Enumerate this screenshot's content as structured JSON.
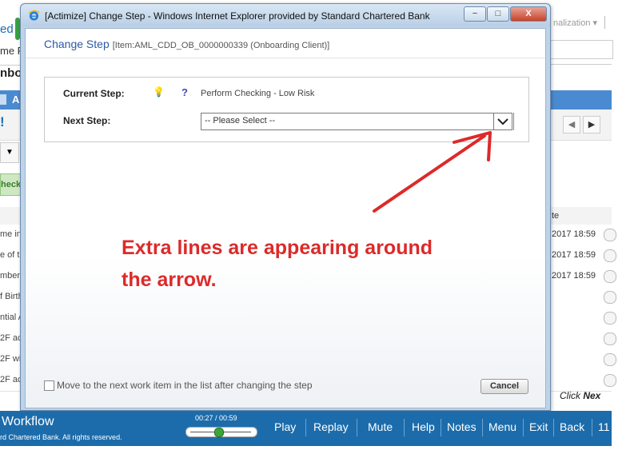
{
  "background": {
    "logo_fragment": "ed",
    "name_fragment": "me F",
    "heading_fragment": "nbo",
    "tab_letter": "A",
    "toolbar_glyph": "!",
    "green_btn_fragment": "heck",
    "personalization": "nalization",
    "list_items": [
      "me in",
      "e of t",
      "mber,",
      "f Birth",
      "ntial A",
      "2F acc",
      "2F wi",
      "2F ac"
    ],
    "column_header": "te",
    "dates": [
      "2017 18:59",
      "2017 18:59",
      "2017 18:59"
    ],
    "click_next_prefix": "Click ",
    "click_next_bold": "Nex"
  },
  "window": {
    "title": "[Actimize] Change Step - Windows Internet Explorer provided by Standard Chartered Bank",
    "min_label": "−",
    "max_label": "□",
    "close_label": "X"
  },
  "dialog": {
    "title": "Change Step",
    "item": "[Item:AML_CDD_OB_0000000339 (Onboarding Client)]",
    "current_step_label": "Current Step:",
    "current_step_value": "Perform Checking - Low Risk",
    "bulb_glyph": "💡",
    "help_glyph": "?",
    "next_step_label": "Next Step:",
    "next_step_placeholder": "-- Please Select --",
    "move_next_label": "Move to the next work item in the list after changing the step",
    "cancel_label": "Cancel"
  },
  "annotation": {
    "text_line1": "Extra lines are appearing around",
    "text_line2": "the arrow.",
    "color": "#dc2a2a"
  },
  "player": {
    "workflow_label": "Workflow",
    "copyright": "rd Chartered Bank. All rights reserved.",
    "time": "00:27 / 00:59",
    "progress": 0.46,
    "buttons": [
      "Play",
      "Replay",
      "Mute",
      "Help",
      "Notes",
      "Menu",
      "Exit",
      "Back"
    ],
    "page_number": "11",
    "bar_color": "#1c6cab"
  }
}
